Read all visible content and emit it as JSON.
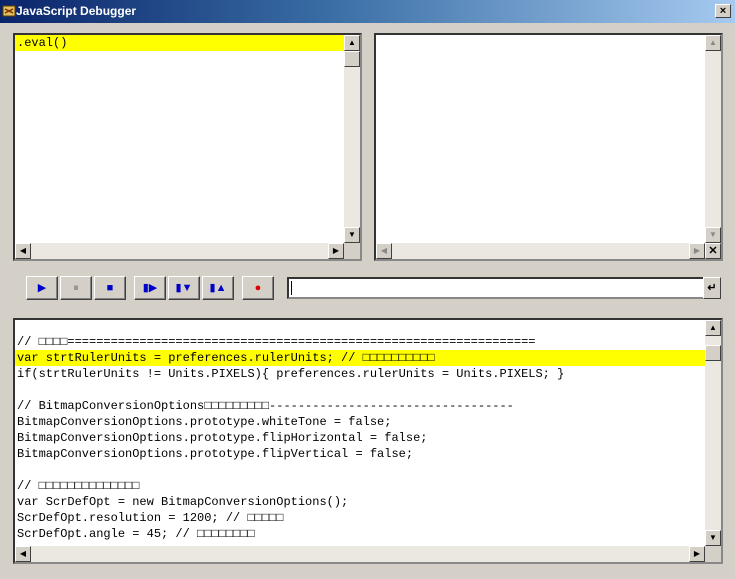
{
  "window": {
    "title": "JavaScript Debugger",
    "close_glyph": "×"
  },
  "stack_pane": {
    "lines": [
      ".eval()"
    ]
  },
  "toolbar": {
    "buttons": [
      {
        "name": "run-button",
        "glyph": "▶",
        "color": "#0000cc"
      },
      {
        "name": "pause-button",
        "glyph": "⏸",
        "color": "#808080"
      },
      {
        "name": "stop-button",
        "glyph": "■",
        "color": "#0000cc"
      },
      {
        "name": "step-over-button",
        "glyph": "▮▶",
        "color": "#0000cc"
      },
      {
        "name": "step-into-button",
        "glyph": "▮▼",
        "color": "#0000cc"
      },
      {
        "name": "step-out-button",
        "glyph": "▮▲",
        "color": "#0000cc"
      },
      {
        "name": "breakpoint-button",
        "glyph": "●",
        "color": "#dd0000"
      }
    ],
    "expression_value": "",
    "enter_glyph": "↵"
  },
  "code": {
    "lines": [
      "// □□□□=================================================================",
      "var strtRulerUnits = preferences.rulerUnits; // □□□□□□□□□□",
      "if(strtRulerUnits != Units.PIXELS){ preferences.rulerUnits = Units.PIXELS; }",
      "",
      "// BitmapConversionOptions□□□□□□□□□----------------------------------",
      "BitmapConversionOptions.prototype.whiteTone = false;",
      "BitmapConversionOptions.prototype.flipHorizontal = false;",
      "BitmapConversionOptions.prototype.flipVertical = false;",
      "",
      "// □□□□□□□□□□□□□□",
      "var ScrDefOpt = new BitmapConversionOptions();",
      "ScrDefOpt.resolution = 1200; // □□□□□",
      "ScrDefOpt.angle = 45; // □□□□□□□□"
    ],
    "highlighted_line": 1
  },
  "colors": {
    "highlight": "#ffff00",
    "title_bar": "#0a246a"
  }
}
